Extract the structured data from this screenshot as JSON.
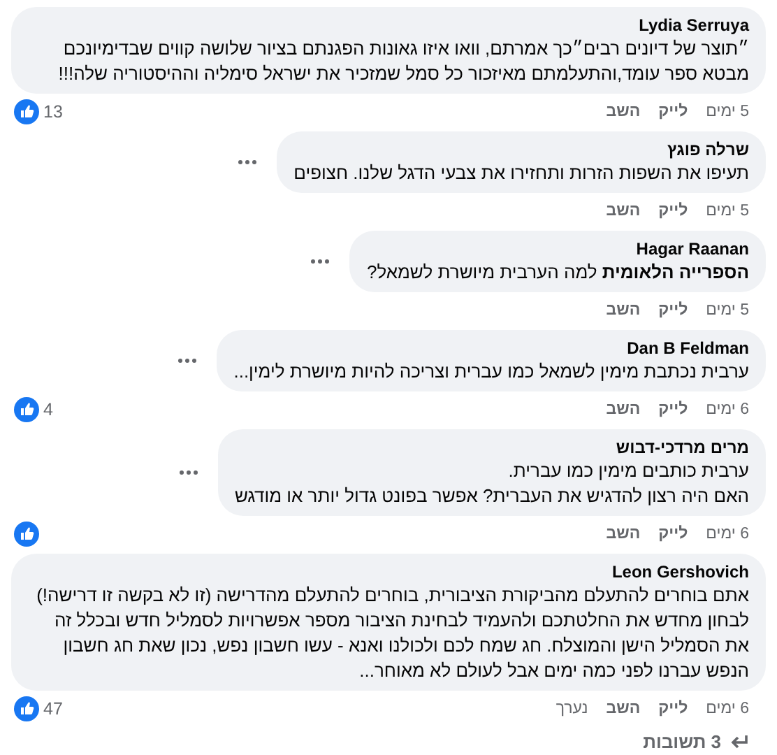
{
  "comments": [
    {
      "author": "Lydia Serruya",
      "text": "״תוצר של דיונים רבים״כך אמרתם, וואו איזו גאונות הפגנתם בציור שלושה קווים שבדימיונכם מבטא ספר עומד,והתעלמתם מאיזכור כל סמל שמזכיר את ישראל סימליה וההיסטוריה שלה!!!",
      "more_button": false,
      "time": "5 ימים",
      "like": "לייק",
      "reply": "השב",
      "reaction": true,
      "reaction_count": "13"
    },
    {
      "author": "שרלה פוגץ",
      "text": "תעיפו את השפות הזרות ותחזירו את צבעי הדגל שלנו. חצופים",
      "more_button": true,
      "time": "5 ימים",
      "like": "לייק",
      "reply": "השב",
      "reaction": false
    },
    {
      "author": "Hagar Raanan",
      "text": "**הספרייה הלאומית** למה הערבית מיושרת לשמאל?",
      "more_button": true,
      "time": "5 ימים",
      "like": "לייק",
      "reply": "השב",
      "reaction": false
    },
    {
      "author": "Dan B Feldman",
      "text": "ערבית נכתבת מימין לשמאל כמו עברית וצריכה להיות מיושרת לימין...",
      "more_button": true,
      "time": "6 ימים",
      "like": "לייק",
      "reply": "השב",
      "reaction": true,
      "reaction_count": "4"
    },
    {
      "author": "מרים מרדכי-דבוש",
      "text": "ערבית כותבים מימין כמו עברית.\nהאם היה רצון להדגיש את העברית? אפשר בפונט גדול יותר או מודגש",
      "more_button": true,
      "time": "6 ימים",
      "like": "לייק",
      "reply": "השב",
      "reaction": true
    },
    {
      "author": "Leon Gershovich",
      "text": "אתם בוחרים להתעלם מהביקורת הציבורית, בוחרים להתעלם מהדרישה (זו לא בקשה זו דרישה!) לבחון מחדש את החלטתכם ולהעמיד לבחינת הציבור מספר אפשרויות לסמליל חדש ובכלל זה את הסמליל הישן והמוצלח. חג שמח לכם ולכולנו ואנא - עשו חשבון נפש, נכון שאת חג חשבון הנפש עברנו לפני כמה ימים אבל לעולם לא מאוחר...",
      "more_button": false,
      "time": "6 ימים",
      "like": "לייק",
      "reply": "השב",
      "edited": "נערך",
      "reaction": true,
      "reaction_count": "47"
    }
  ],
  "replies_link": "3 תשובות"
}
